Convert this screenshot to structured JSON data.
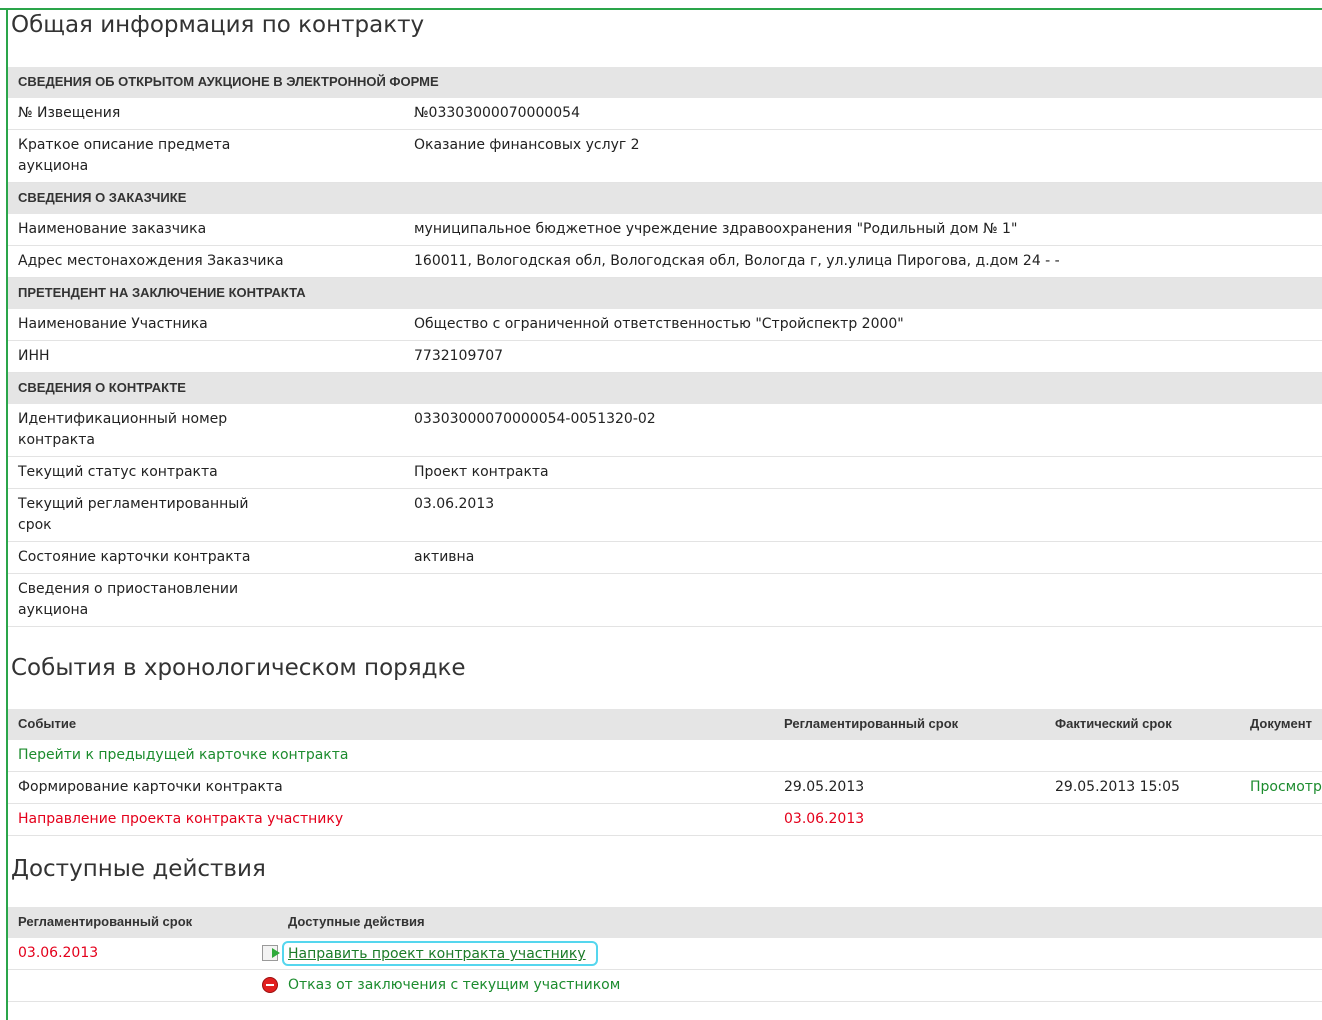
{
  "general": {
    "title": "Общая информация по контракту",
    "sections": [
      {
        "heading": "СВЕДЕНИЯ ОБ ОТКРЫТОМ АУКЦИОНЕ В ЭЛЕКТРОННОЙ ФОРМЕ",
        "rows": [
          {
            "label": "№ Извещения",
            "value": "№03303000070000054"
          },
          {
            "label": "Краткое описание предмета аукциона",
            "value": "Оказание финансовых услуг 2"
          }
        ]
      },
      {
        "heading": "СВЕДЕНИЯ О ЗАКАЗЧИКЕ",
        "rows": [
          {
            "label": "Наименование заказчика",
            "value": "муниципальное бюджетное учреждение здравоохранения \"Родильный дом № 1\""
          },
          {
            "label": "Адрес местонахождения Заказчика",
            "value": "160011, Вологодская обл, Вологодская обл, Вологда г, ул.улица Пирогова, д.дом 24 - -"
          }
        ]
      },
      {
        "heading": "ПРЕТЕНДЕНТ НА ЗАКЛЮЧЕНИЕ КОНТРАКТА",
        "rows": [
          {
            "label": "Наименование Участника",
            "value": "Общество с ограниченной ответственностью \"Стройспектр 2000\""
          },
          {
            "label": "ИНН",
            "value": "7732109707"
          }
        ]
      },
      {
        "heading": "СВЕДЕНИЯ О КОНТРАКТЕ",
        "rows": [
          {
            "label": "Идентификационный номер контракта",
            "value": "03303000070000054-0051320-02"
          },
          {
            "label": "Текущий статус контракта",
            "value": "Проект контракта"
          },
          {
            "label": "Текущий регламентированный срок",
            "value": "03.06.2013"
          },
          {
            "label": "Состояние карточки контракта",
            "value": "активна"
          },
          {
            "label": "Сведения о приостановлении аукциона",
            "value": ""
          }
        ]
      }
    ]
  },
  "events": {
    "title": "События в хронологическом порядке",
    "headers": {
      "event": "Событие",
      "deadline": "Регламентированный срок",
      "actual": "Фактический срок",
      "document": "Документ"
    },
    "prev_link": "Перейти к предыдущей карточке контракта",
    "rows": [
      {
        "event": "Формирование карточки контракта",
        "deadline": "29.05.2013",
        "actual": "29.05.2013 15:05",
        "document": "Просмотр"
      },
      {
        "event": "Направление проекта контракта участнику",
        "deadline": "03.06.2013",
        "actual": "",
        "document": ""
      }
    ]
  },
  "actions": {
    "title": "Доступные действия",
    "headers": {
      "deadline": "Регламентированный срок",
      "actions": "Доступные действия"
    },
    "rows": [
      {
        "deadline": "03.06.2013",
        "icon": "document-send-icon",
        "label": "Направить проект контракта участнику"
      },
      {
        "deadline": "",
        "icon": "stop-icon",
        "label": "Отказ от заключения с текущим участником"
      }
    ]
  },
  "colors": {
    "accent_green": "#1c8c2e",
    "alert_red": "#e4001b",
    "frame_green": "#2aa54a",
    "header_gray": "#e5e5e5"
  }
}
